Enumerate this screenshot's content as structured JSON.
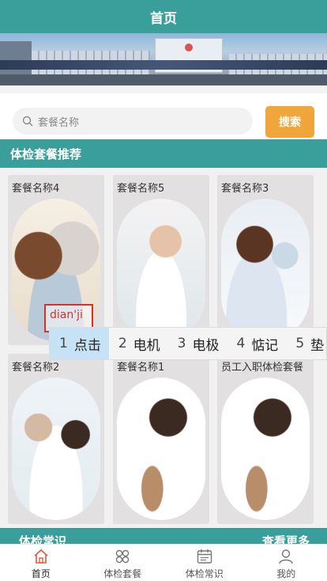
{
  "header": {
    "title": "首页"
  },
  "search": {
    "placeholder": "套餐名称",
    "button_label": "搜索"
  },
  "section": {
    "title": "体检套餐推荐"
  },
  "cards": [
    {
      "title": "套餐名称4"
    },
    {
      "title": "套餐名称5"
    },
    {
      "title": "套餐名称3"
    },
    {
      "title": "套餐名称2"
    },
    {
      "title": "套餐名称1"
    },
    {
      "title": "员工入职体检套餐"
    }
  ],
  "ime": {
    "composition": "dian'ji",
    "candidates": [
      {
        "num": "1",
        "text": "点击"
      },
      {
        "num": "2",
        "text": "电机"
      },
      {
        "num": "3",
        "text": "电极"
      },
      {
        "num": "4",
        "text": "惦记"
      },
      {
        "num": "5",
        "text": "垫"
      }
    ]
  },
  "strip": {
    "left": "体检常识",
    "right": "查看更多"
  },
  "tabbar": {
    "items": [
      {
        "label": "首页",
        "icon": "home-icon"
      },
      {
        "label": "体检套餐",
        "icon": "grid-icon"
      },
      {
        "label": "体检常识",
        "icon": "calendar-icon"
      },
      {
        "label": "我的",
        "icon": "user-icon"
      }
    ]
  },
  "colors": {
    "primary": "#3a9e9a",
    "accent": "#f0a63a",
    "home_active": "#e05a3a",
    "ime_highlight": "#c7e2f5"
  }
}
